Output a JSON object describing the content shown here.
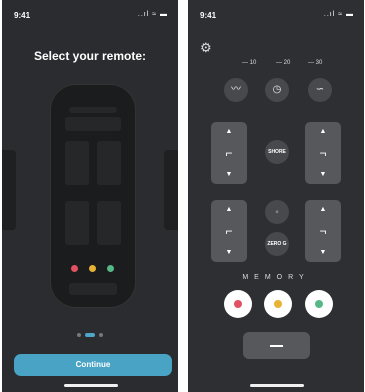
{
  "screen1": {
    "time": "9:41",
    "status_icons": "..ıl ≈ ▬",
    "title": "Select your remote:",
    "continue_label": "Continue",
    "pager": {
      "pages": 3,
      "active_index": 1
    }
  },
  "screen2": {
    "time": "9:41",
    "status_icons": "..ıl ≈ ▬",
    "presets": [
      "10",
      "20",
      "30"
    ],
    "shore_label": "SHORE",
    "zerog_label": "ZERO G",
    "memory_label": "MEMORY",
    "memory_colors": [
      "#e2515f",
      "#e8b334",
      "#56b886"
    ]
  },
  "colors": {
    "accent": "#48a3c4"
  }
}
